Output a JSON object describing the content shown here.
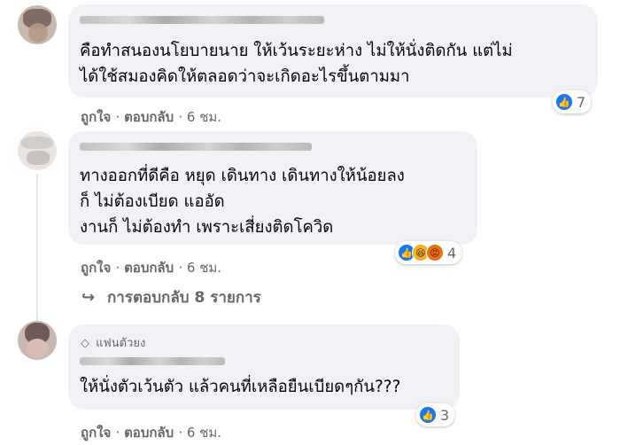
{
  "comments": [
    {
      "text_lines": [
        "คือทำสนองนโยบายนาย ให้เว้นระยะห่าง ไม่ให้นั่งติดกัน แต่ไม่",
        "ได้ใช้สมองคิดให้ตลอดว่าจะเกิดอะไรขึ้นตามมา"
      ],
      "like_label": "ถูกใจ",
      "reply_label": "ตอบกลับ",
      "time": "6 ชม.",
      "reaction_count": "7",
      "reaction_icons": [
        "like-icon"
      ]
    },
    {
      "text_lines": [
        "ทางออกที่ดีคือ หยุด เดินทาง เดินทางให้น้อยลง",
        "ก็ ไม่ต้องเบียด แออัด",
        "งานก็ ไม่ต้องทำ เพราะเสี่ยงติดโควิด"
      ],
      "like_label": "ถูกใจ",
      "reply_label": "ตอบกลับ",
      "time": "6 ชม.",
      "reaction_count": "4",
      "reaction_icons": [
        "like-icon",
        "haha-icon",
        "angry-icon"
      ],
      "replies_label": "การตอบกลับ 8 รายการ"
    },
    {
      "badge": "แฟนตัวยง",
      "text_lines": [
        "ให้นั่งตัวเว้นตัว แล้วคนที่เหลือยืนเบียดๆกัน???"
      ],
      "like_label": "ถูกใจ",
      "reply_label": "ตอบกลับ",
      "time": "6 ชม.",
      "reaction_count": "3",
      "reaction_icons": [
        "like-icon"
      ]
    }
  ],
  "colors": {
    "bubble": "#f0f2f5",
    "meta_text": "#65676b",
    "like_blue": "#1877f2"
  }
}
